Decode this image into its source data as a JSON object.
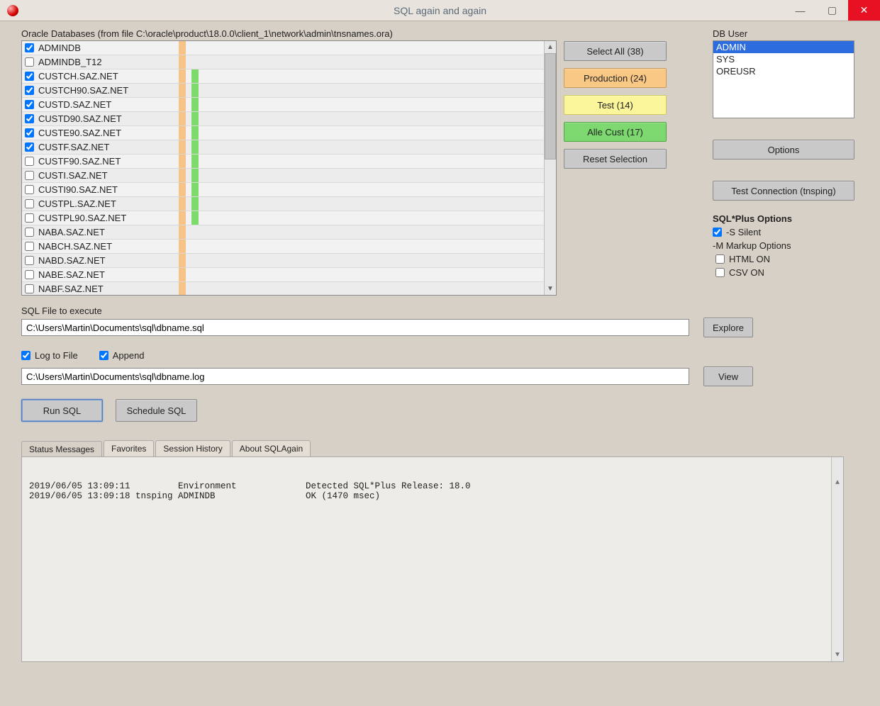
{
  "window": {
    "title": "SQL again and again"
  },
  "databases": {
    "label": "Oracle Databases (from file C:\\oracle\\product\\18.0.0\\client_1\\network\\admin\\tnsnames.ora)",
    "rows": [
      {
        "name": "ADMINDB",
        "checked": true,
        "green": false
      },
      {
        "name": "ADMINDB_T12",
        "checked": false,
        "green": false
      },
      {
        "name": "CUSTCH.SAZ.NET",
        "checked": true,
        "green": true
      },
      {
        "name": "CUSTCH90.SAZ.NET",
        "checked": true,
        "green": true
      },
      {
        "name": "CUSTD.SAZ.NET",
        "checked": true,
        "green": true
      },
      {
        "name": "CUSTD90.SAZ.NET",
        "checked": true,
        "green": true
      },
      {
        "name": "CUSTE90.SAZ.NET",
        "checked": true,
        "green": true
      },
      {
        "name": "CUSTF.SAZ.NET",
        "checked": true,
        "green": true
      },
      {
        "name": "CUSTF90.SAZ.NET",
        "checked": false,
        "green": true
      },
      {
        "name": "CUSTI.SAZ.NET",
        "checked": false,
        "green": true
      },
      {
        "name": "CUSTI90.SAZ.NET",
        "checked": false,
        "green": true
      },
      {
        "name": "CUSTPL.SAZ.NET",
        "checked": false,
        "green": true
      },
      {
        "name": "CUSTPL90.SAZ.NET",
        "checked": false,
        "green": true
      },
      {
        "name": "NABA.SAZ.NET",
        "checked": false,
        "green": false
      },
      {
        "name": "NABCH.SAZ.NET",
        "checked": false,
        "green": false
      },
      {
        "name": "NABD.SAZ.NET",
        "checked": false,
        "green": false
      },
      {
        "name": "NABE.SAZ.NET",
        "checked": false,
        "green": false
      },
      {
        "name": "NABF.SAZ.NET",
        "checked": false,
        "green": false
      }
    ]
  },
  "selection_buttons": {
    "select_all": "Select All (38)",
    "production": "Production (24)",
    "test": "Test (14)",
    "cust": "Alle Cust (17)",
    "reset": "Reset Selection"
  },
  "right": {
    "db_user_label": "DB User",
    "users": [
      "ADMIN",
      "SYS",
      "OREUSR"
    ],
    "selected_user": "ADMIN",
    "options_btn": "Options",
    "test_conn_btn": "Test Connection (tnsping)",
    "sqlplus_heading": "SQL*Plus Options",
    "silent_label": "-S Silent",
    "silent_checked": true,
    "markup_label": "-M Markup Options",
    "html_on_label": "HTML ON",
    "html_on_checked": false,
    "csv_on_label": "CSV ON",
    "csv_on_checked": false
  },
  "sqlfile": {
    "label": "SQL File to execute",
    "value": "C:\\Users\\Martin\\Documents\\sql\\dbname.sql",
    "explore_btn": "Explore"
  },
  "log": {
    "log_to_file_label": "Log to File",
    "log_to_file_checked": true,
    "append_label": "Append",
    "append_checked": true,
    "value": "C:\\Users\\Martin\\Documents\\sql\\dbname.log",
    "view_btn": "View"
  },
  "action": {
    "run": "Run SQL",
    "schedule": "Schedule SQL"
  },
  "tabs": {
    "status": "Status Messages",
    "favorites": "Favorites",
    "session": "Session History",
    "about": "About SQLAgain"
  },
  "status_lines": [
    {
      "c1": "2019/06/05 13:09:11",
      "c2": "Environment",
      "c3": "Detected SQL*Plus Release: 18.0"
    },
    {
      "c1": "2019/06/05 13:09:18 tnsping",
      "c2": "ADMINDB",
      "c3": "OK (1470 msec)"
    }
  ]
}
